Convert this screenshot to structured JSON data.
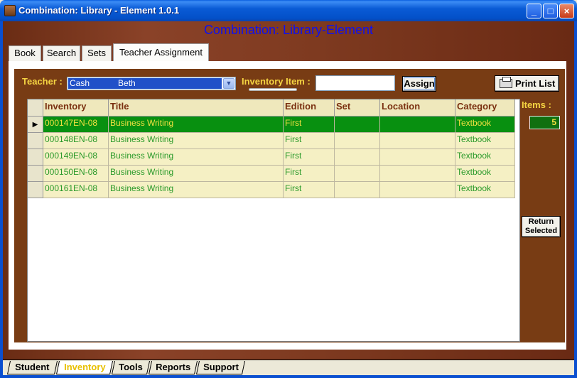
{
  "window": {
    "title": "Combination: Library - Element 1.0.1",
    "minimize": "_",
    "maximize": "□",
    "close": "×"
  },
  "header": {
    "title": "Combination:  Library-Element"
  },
  "tabs": [
    {
      "label": "Book"
    },
    {
      "label": "Search"
    },
    {
      "label": "Sets"
    },
    {
      "label": "Teacher Assignment",
      "active": true
    }
  ],
  "form": {
    "teacher_label": "Teacher :",
    "teacher_value": "Cash            Beth",
    "dropdown_arrow": "▼",
    "inventory_label": "Inventory Item :",
    "inventory_value": "",
    "assign_label": "Assign",
    "print_label": "Print List"
  },
  "grid": {
    "columns": [
      "Inventory",
      "Title",
      "Edition",
      "Set",
      "Location",
      "Category"
    ],
    "selector_glyph": "▶",
    "rows": [
      {
        "inventory": "000147EN-08",
        "title": "Business Writing",
        "edition": "First",
        "set": "",
        "location": "",
        "category": "Textbook",
        "selected": true
      },
      {
        "inventory": "000148EN-08",
        "title": "Business Writing",
        "edition": "First",
        "set": "",
        "location": "",
        "category": "Textbook"
      },
      {
        "inventory": "000149EN-08",
        "title": "Business Writing",
        "edition": "First",
        "set": "",
        "location": "",
        "category": "Textbook"
      },
      {
        "inventory": "000150EN-08",
        "title": "Business Writing",
        "edition": "First",
        "set": "",
        "location": "",
        "category": "Textbook"
      },
      {
        "inventory": "000161EN-08",
        "title": "Business Writing",
        "edition": "First",
        "set": "",
        "location": "",
        "category": "Textbook"
      }
    ]
  },
  "side": {
    "items_label": "Items :",
    "items_count": "5",
    "return_label_1": "Return",
    "return_label_2": "Selected"
  },
  "bottom_tabs": [
    {
      "label": "Student"
    },
    {
      "label": "Inventory",
      "active": true
    },
    {
      "label": "Tools"
    },
    {
      "label": "Reports"
    },
    {
      "label": "Support"
    }
  ]
}
